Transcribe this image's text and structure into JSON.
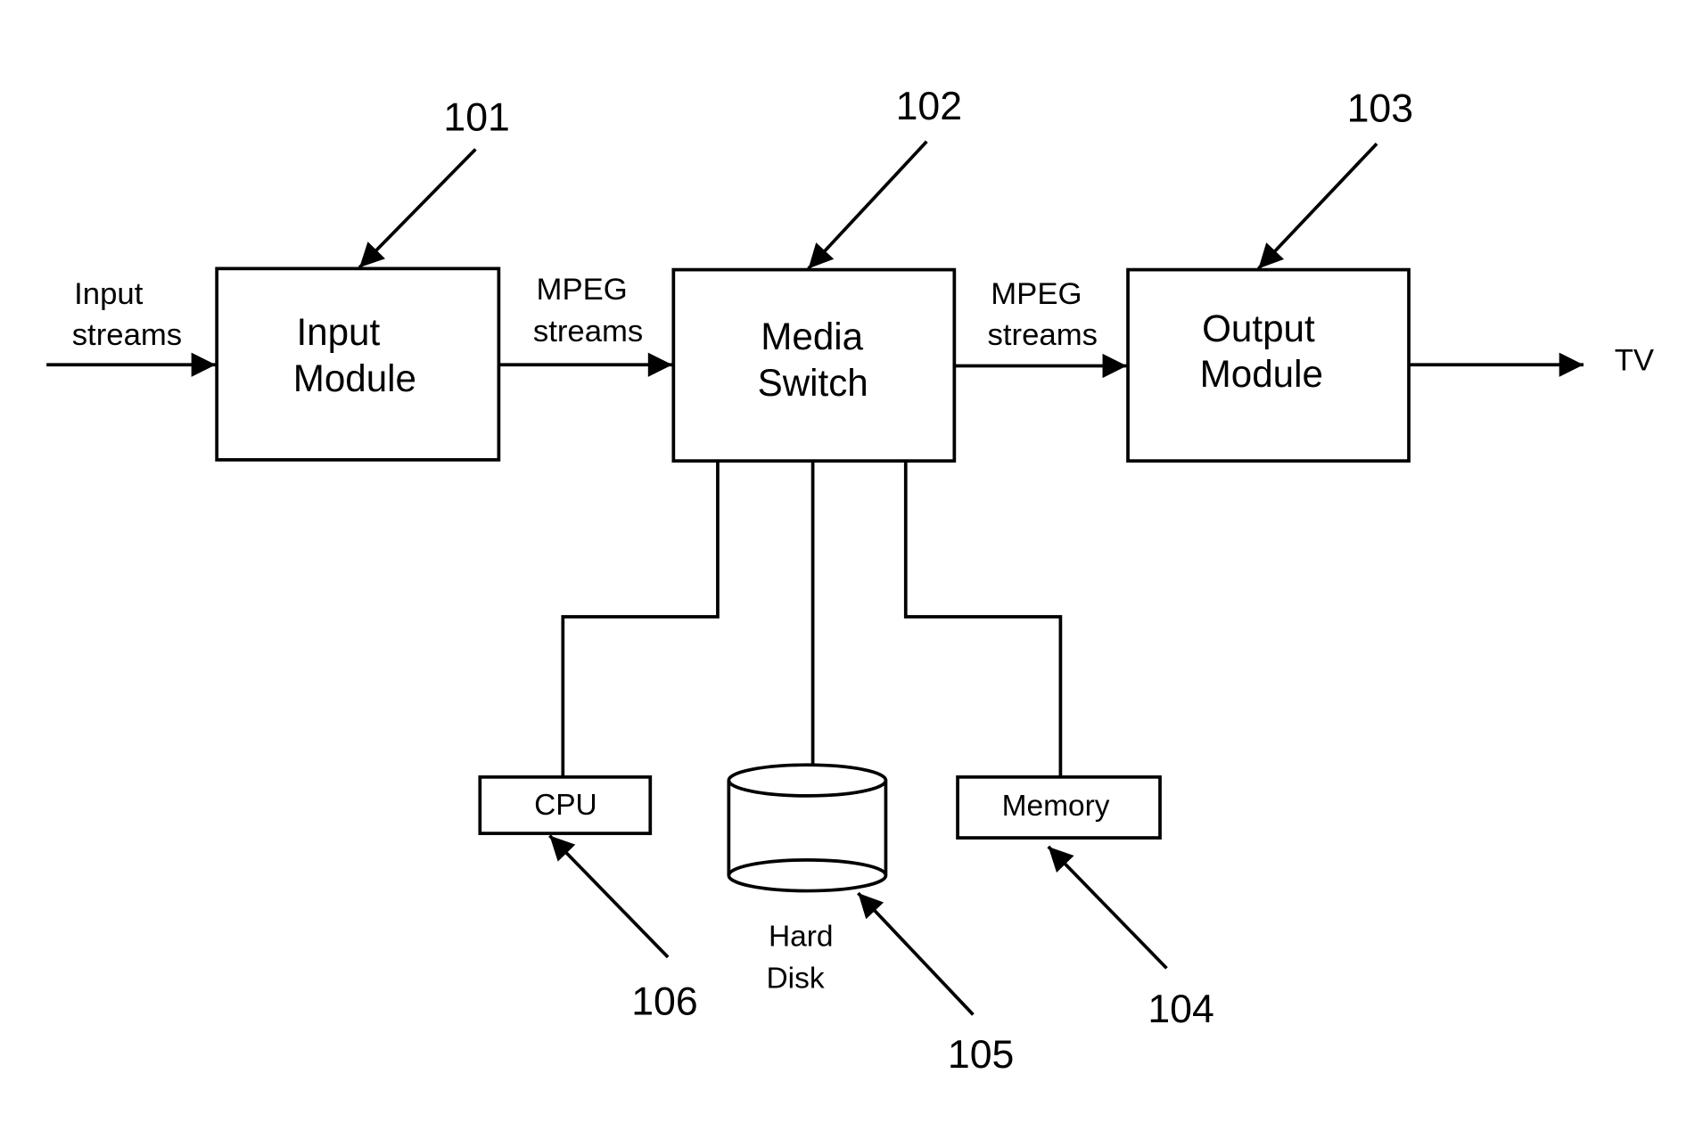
{
  "diagram": {
    "blocks": {
      "input_module": {
        "line1": "Input",
        "line2": "Module",
        "ref": "101"
      },
      "media_switch": {
        "line1": "Media",
        "line2": "Switch",
        "ref": "102"
      },
      "output_module": {
        "line1": "Output",
        "line2": "Module",
        "ref": "103"
      },
      "memory": {
        "label": "Memory",
        "ref": "104"
      },
      "hard_disk": {
        "line1": "Hard",
        "line2": "Disk",
        "ref": "105"
      },
      "cpu": {
        "label": "CPU",
        "ref": "106"
      }
    },
    "flows": {
      "input": {
        "line1": "Input",
        "line2": "streams"
      },
      "mpeg_1": {
        "line1": "MPEG",
        "line2": "streams"
      },
      "mpeg_2": {
        "line1": "MPEG",
        "line2": "streams"
      },
      "output": {
        "label": "TV"
      }
    }
  }
}
